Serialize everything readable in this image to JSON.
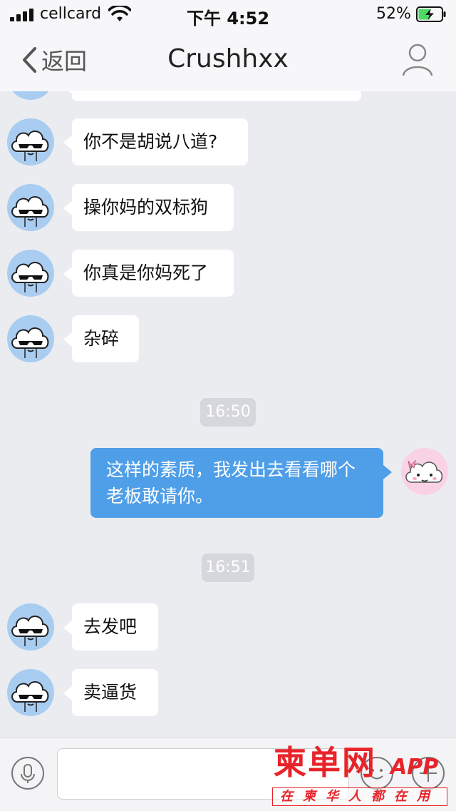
{
  "status_bar": {
    "carrier": "cellcard",
    "time": "下午 4:52",
    "battery_percent": "52%",
    "battery_level": 0.52,
    "charging": true
  },
  "nav": {
    "back_label": "返回",
    "title": "Crushhxx",
    "profile_icon": "person-icon"
  },
  "messages": [
    {
      "side": "in",
      "text": "你不是胡说八道?"
    },
    {
      "side": "in",
      "text": "操你妈的双标狗"
    },
    {
      "side": "in",
      "text": "你真是你妈死了"
    },
    {
      "side": "in",
      "text": "杂碎"
    },
    {
      "type": "time",
      "text": "16:50"
    },
    {
      "side": "out",
      "text": "这样的素质，我发出去看看哪个老板敢请你。"
    },
    {
      "type": "time",
      "text": "16:51"
    },
    {
      "side": "in",
      "text": "去发吧"
    },
    {
      "side": "in",
      "text": "卖逼货"
    }
  ],
  "input_bar": {
    "voice_icon": "microphone-icon",
    "text_value": "",
    "emoji_icon": "emoji-icon",
    "plus_icon": "plus-icon"
  },
  "watermark": {
    "logo": "柬单网",
    "app": "APP",
    "slogan": "在柬华人都在用"
  },
  "colors": {
    "background": "#ebecf0",
    "outgoing_bubble": "#4e9ee8",
    "incoming_bubble": "#ffffff",
    "watermark": "#e8232a"
  }
}
